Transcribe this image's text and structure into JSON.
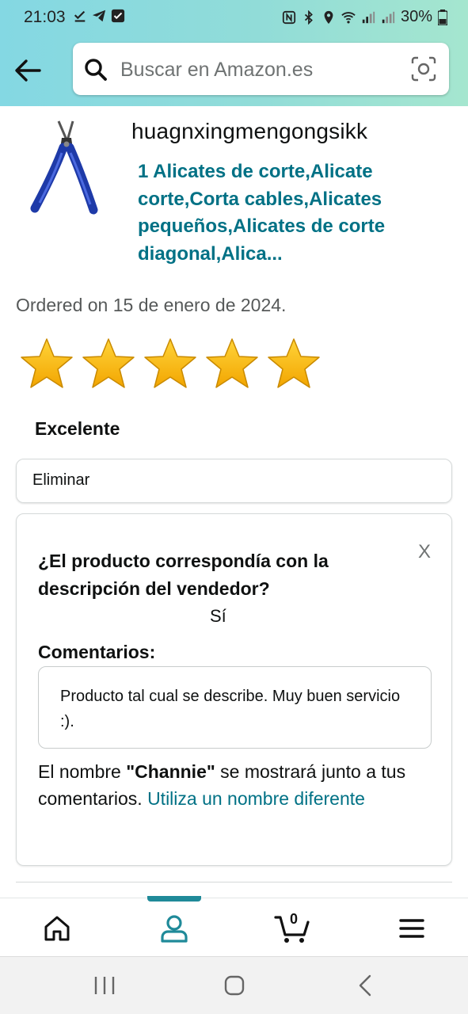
{
  "status_bar": {
    "time": "21:03",
    "battery": "30%"
  },
  "header": {
    "back_icon": "arrow-left-icon",
    "search_placeholder": "Buscar en Amazon.es",
    "camera_icon": "camera-scan-icon"
  },
  "product": {
    "image_icon": "pliers-image",
    "brand": "huagnxingmengongsikk",
    "title": "1 Alicates de corte,Alicate corte,Corta cables,Alicates pequeños,Alicates de corte diagonal,Alica..."
  },
  "order": {
    "ordered_text": "Ordered on 15 de enero de 2024."
  },
  "review": {
    "stars_filled": 5,
    "stars_total": 5,
    "rating_label": "Excelente",
    "delete_label": "Eliminar"
  },
  "feedback_card": {
    "close_label": "X",
    "question": "¿El producto correspondía con la descripción del vendedor?",
    "answer": "Sí",
    "comments_label": "Comentarios:",
    "comment_text": "Producto tal cual se describe. Muy buen servicio :).",
    "name_note_prefix": "El nombre ",
    "name_value": "\"Channie\"",
    "name_note_suffix": " se mostrará junto a tus comentarios. ",
    "name_link": "Utiliza un nombre diferente"
  },
  "bottom_nav": {
    "items": [
      "home-icon",
      "account-icon",
      "cart-icon",
      "menu-icon"
    ],
    "active": "account-icon",
    "cart_count": "0"
  },
  "colors": {
    "accent_teal": "#007185",
    "nav_indicator": "#1f8a99",
    "star_gold": "#f7b600"
  }
}
